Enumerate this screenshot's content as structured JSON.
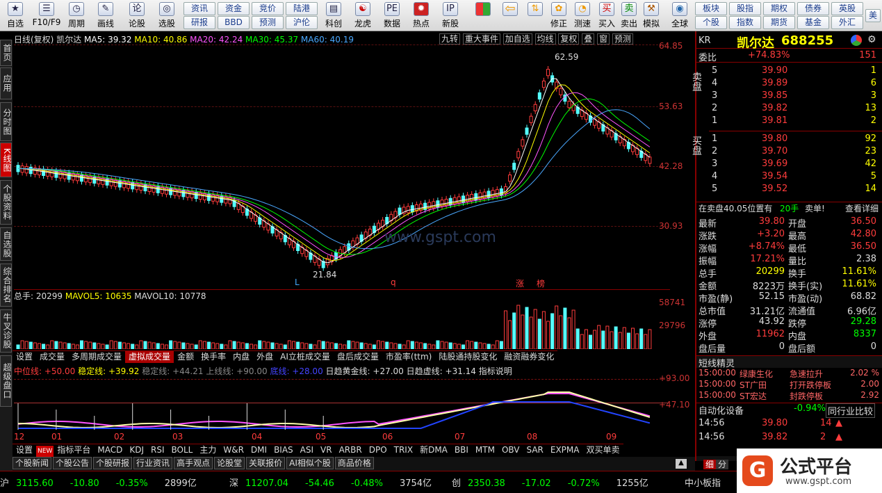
{
  "toolbar": {
    "items": [
      {
        "label": "自选",
        "icon": "star"
      },
      {
        "label": "F10/F9",
        "icon": "list"
      },
      {
        "label": "周期",
        "icon": "clock"
      },
      {
        "label": "画线",
        "icon": "pen"
      },
      {
        "label": "论股",
        "icon": "chat"
      },
      {
        "label": "选股",
        "icon": "pick"
      }
    ],
    "mid_buttons": [
      [
        "资讯",
        "资金",
        "竞价",
        "陆港"
      ],
      [
        "研报",
        "BBD",
        "预测",
        "沪伦"
      ]
    ],
    "apps": [
      {
        "label": "科创"
      },
      {
        "label": "龙虎"
      },
      {
        "label": "数据"
      },
      {
        "label": "热点"
      },
      {
        "label": "新股"
      }
    ],
    "right_items": [
      {
        "label": "修正"
      },
      {
        "label": "测速"
      },
      {
        "label": "买入"
      },
      {
        "label": "卖出"
      },
      {
        "label": "模拟"
      },
      {
        "label": "全球"
      }
    ],
    "right_buttons": [
      [
        "板块",
        "股指",
        "期权",
        "债券",
        "英股"
      ],
      [
        "个股",
        "指数",
        "期货",
        "基金",
        "外汇"
      ]
    ],
    "more": "美"
  },
  "leftnav": [
    "首页",
    "应用",
    "分时图",
    "K线图",
    "个股资料",
    "自选股",
    "综合排名",
    "牛叉诊股",
    "超级盘口"
  ],
  "chart": {
    "title": "日线(复权)",
    "stock": "凯尔达",
    "ma": [
      {
        "label": "MA5: 39.32",
        "color": "#ffffff"
      },
      {
        "label": "MA10: 40.86",
        "color": "#ffff00"
      },
      {
        "label": "MA20: 42.24",
        "color": "#ff55ff"
      },
      {
        "label": "MA30: 45.37",
        "color": "#00ff00"
      },
      {
        "label": "MA60: 40.19",
        "color": "#4aa8ff"
      }
    ],
    "top_right_tabs": [
      "九转",
      "重大事件",
      "加自选",
      "均线",
      "复权",
      "叠",
      "窗",
      "预测"
    ],
    "price_axis": [
      "64.85",
      "53.63",
      "42.28",
      "30.93"
    ],
    "high_label": "62.59",
    "low_label": "21.84",
    "watermark": "www.gspt.com",
    "markers": [
      "L",
      "q",
      "涨",
      "榜"
    ],
    "vol": {
      "label": "总手: 20299",
      "mavol5": "MAVOL5: 10635",
      "mavol10": "MAVOL10: 10778",
      "axis": [
        "58741",
        "29796"
      ]
    },
    "tabs1": [
      "设置",
      "成交量",
      "多周期成交量",
      "虚拟成交量",
      "金额",
      "换手率",
      "内盘",
      "外盘",
      "AI立桩成交量",
      "盘后成交量",
      "市盈率(ttm)",
      "陆股通持股变化",
      "融资融券变化"
    ],
    "ind": {
      "items": [
        "中位线: +50.00",
        "稳定线: +39.92",
        "稳定线: +44.21",
        "上线线: +90.00",
        "底线: +28.00",
        "日趋黄金线: +27.00",
        "日趋虚线: +31.14",
        "指标说明"
      ],
      "axis": [
        "+93.00",
        "+47.10"
      ]
    },
    "months": [
      "12",
      "01",
      "02",
      "03",
      "04",
      "05",
      "06",
      "07",
      "08",
      "09"
    ],
    "tabs2": [
      "设置",
      "NEW",
      "指标平台",
      "MACD",
      "KDJ",
      "RSI",
      "BOLL",
      "主力",
      "W&R",
      "DMI",
      "BIAS",
      "ASI",
      "VR",
      "ARBR",
      "DPO",
      "TRIX",
      "新DMA",
      "BBI",
      "MTM",
      "OBV",
      "SAR",
      "EXPMA",
      "双买单卖"
    ],
    "bottom_tabs": [
      "个股新闻",
      "个股公告",
      "个股研报",
      "行业资讯",
      "高手观点",
      "论股堂",
      "关联报价",
      "AI相似个股",
      "商品价格"
    ]
  },
  "quote": {
    "code": "KR",
    "name": "凯尔达",
    "num": "688255",
    "weibi": {
      "label": "委比",
      "pct": "+74.83%",
      "val": "151"
    },
    "sell": [
      [
        "5",
        "39.90",
        "1"
      ],
      [
        "4",
        "39.89",
        "6"
      ],
      [
        "3",
        "39.85",
        "3"
      ],
      [
        "2",
        "39.82",
        "13"
      ],
      [
        "1",
        "39.81",
        "2"
      ]
    ],
    "buy": [
      [
        "1",
        "39.80",
        "92"
      ],
      [
        "2",
        "39.70",
        "23"
      ],
      [
        "3",
        "39.69",
        "42"
      ],
      [
        "4",
        "39.54",
        "5"
      ],
      [
        "5",
        "39.52",
        "14"
      ]
    ],
    "sell_label": "卖盘",
    "buy_label": "买盘",
    "note": "在卖盘40.05位置有",
    "note2": "20手",
    "note3": "卖单!",
    "note4": "查看详细",
    "fields": [
      [
        "最新",
        "39.80",
        "开盘",
        "36.50"
      ],
      [
        "涨跌",
        "+3.20",
        "最高",
        "42.80"
      ],
      [
        "涨幅",
        "+8.74%",
        "最低",
        "36.50"
      ],
      [
        "振幅",
        "17.21%",
        "量比",
        "2.38"
      ],
      [
        "总手",
        "20299",
        "换手",
        "11.61%"
      ],
      [
        "金额",
        "8223万",
        "换手(实)",
        "11.61%"
      ],
      [
        "市盈(静)",
        "52.15",
        "市盈(动)",
        "68.82"
      ],
      [
        "总市值",
        "31.21亿",
        "流通值",
        "6.96亿"
      ],
      [
        "涨停",
        "43.92",
        "跌停",
        "29.28"
      ],
      [
        "外盘",
        "11962",
        "内盘",
        "8337"
      ],
      [
        "盘后量",
        "0",
        "盘后额",
        "0"
      ]
    ],
    "sprite_title": "短线精灵",
    "sprites": [
      [
        "15:00:00",
        "绿康生化",
        "急速拉升",
        "2.02 %"
      ],
      [
        "15:00:00",
        "ST广田",
        "打开跌停板",
        "2.00"
      ],
      [
        "15:00:00",
        "ST宏达",
        "封跌停板",
        "2.92"
      ]
    ],
    "sector": {
      "name": "自动化设备",
      "pct": "-0.94%",
      "cmp": "同行业比较"
    },
    "ticks": [
      [
        "14:56",
        "39.80",
        "14"
      ],
      [
        "14:56",
        "39.82",
        "2"
      ]
    ],
    "ticks_tail": [
      "细",
      "分"
    ]
  },
  "status": {
    "items": [
      [
        "沪",
        "3115.60",
        "-10.80",
        "-0.35%",
        "2899亿"
      ],
      [
        "深",
        "11207.04",
        "-54.46",
        "-0.48%",
        "3754亿"
      ],
      [
        "创",
        "2350.38",
        "-17.02",
        "-0.72%",
        "1255亿"
      ]
    ],
    "tail": "中小板指"
  },
  "logo": {
    "text": "公式平台",
    "url": "www.gspt.com"
  }
}
